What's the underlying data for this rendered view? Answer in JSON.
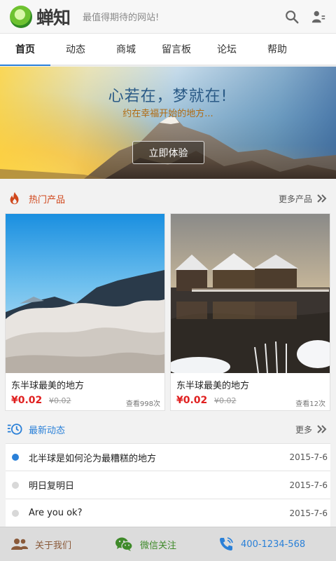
{
  "header": {
    "logo_text": "蝉知",
    "slogan": "最值得期待的网站!",
    "icons": [
      "search-icon",
      "user-menu-icon"
    ]
  },
  "nav": {
    "items": [
      {
        "label": "首页",
        "active": true
      },
      {
        "label": "动态"
      },
      {
        "label": "商城"
      },
      {
        "label": "留言板"
      },
      {
        "label": "论坛"
      },
      {
        "label": "帮助"
      }
    ]
  },
  "banner": {
    "title": "心若在，梦就在!",
    "subtitle": "约在幸福开始的地方...",
    "button": "立即体验"
  },
  "products": {
    "title": "热门产品",
    "more": "更多产品",
    "title_color": "#d0471c",
    "items": [
      {
        "name": "东半球最美的地方",
        "price": "¥0.02",
        "old_price": "¥0.02",
        "views": "查看998次"
      },
      {
        "name": "东半球最美的地方",
        "price": "¥0.02",
        "old_price": "¥0.02",
        "views": "查看12次"
      }
    ]
  },
  "news": {
    "title": "最新动态",
    "more": "更多",
    "title_color": "#2a80d8",
    "items": [
      {
        "title": "北半球是如何沦为最糟糕的地方",
        "date": "2015-7-6"
      },
      {
        "title": "明日复明日",
        "date": "2015-7-6"
      },
      {
        "title": "Are you ok?",
        "date": "2015-7-6"
      }
    ]
  },
  "footer": {
    "about": "关于我们",
    "wechat": "微信关注",
    "phone": "400-1234-568",
    "colors": {
      "about": "#8a5a3a",
      "wechat": "#3f8a2a",
      "phone": "#2a80d8"
    }
  }
}
